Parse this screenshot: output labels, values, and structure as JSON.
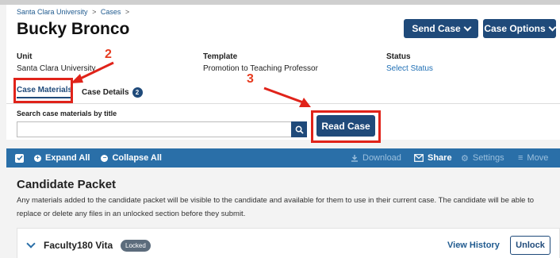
{
  "breadcrumb": [
    "Santa Clara University",
    ">",
    "Cases",
    ">"
  ],
  "page_title": "Bucky Bronco",
  "header_buttons": {
    "send_case": "Send Case",
    "case_options": "Case Options"
  },
  "fields": {
    "unit": {
      "label": "Unit",
      "value": "Santa Clara University"
    },
    "template": {
      "label": "Template",
      "value": "Promotion to Teaching Professor"
    },
    "status": {
      "label": "Status",
      "value": "Select Status"
    }
  },
  "tabs": [
    {
      "label": "Case Materials",
      "active": true
    },
    {
      "label": "Case Details",
      "badge": "2"
    }
  ],
  "annotations": {
    "num2": "2",
    "num3": "3",
    "color": "#e0231a"
  },
  "search": {
    "label": "Search case materials by title",
    "value": "",
    "placeholder": ""
  },
  "read_case": "Read Case",
  "toolbar": {
    "expand_all": "Expand All",
    "collapse_all": "Collapse All",
    "download": "Download",
    "share": "Share",
    "settings": "Settings",
    "move": "Move"
  },
  "section": {
    "title": "Candidate Packet",
    "description": "Any materials added to the candidate packet will be visible to the candidate and available for them to use in their current case. The candidate will be able to replace or delete any files in an unlocked section before they submit."
  },
  "panel": {
    "title": "Faculty180 Vita",
    "badge": "Locked",
    "view_history": "View History",
    "unlock": "Unlock"
  },
  "colors": {
    "primary": "#1f4a7a",
    "toolbar": "#2a6fa8",
    "link": "#1f6fb5"
  }
}
